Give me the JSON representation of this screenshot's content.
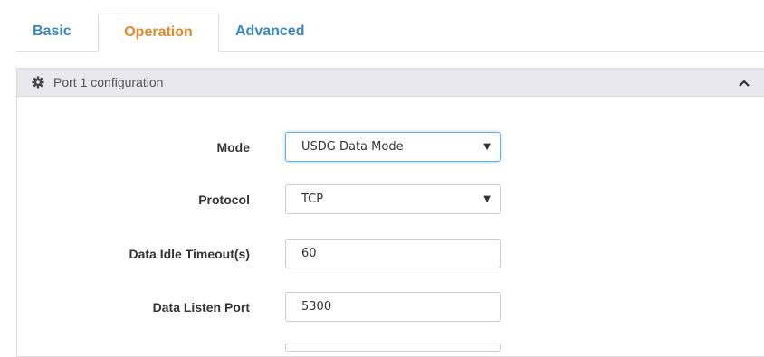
{
  "tabs": [
    {
      "label": "Basic"
    },
    {
      "label": "Operation"
    },
    {
      "label": "Advanced"
    }
  ],
  "panel": {
    "title": "Port 1 configuration",
    "icon": "gear-icon",
    "collapse_icon": "chevron-up-icon",
    "header_color": "#e9e8ef"
  },
  "form": {
    "mode": {
      "label": "Mode",
      "value": "USDG Data Mode"
    },
    "protocol": {
      "label": "Protocol",
      "value": "TCP"
    },
    "idle_timeout": {
      "label": "Data Idle Timeout(s)",
      "value": "60"
    },
    "listen_port": {
      "label": "Data Listen Port",
      "value": "5300"
    }
  },
  "colors": {
    "tab_link": "#3a87c8",
    "tab_active": "#e08a2c"
  }
}
